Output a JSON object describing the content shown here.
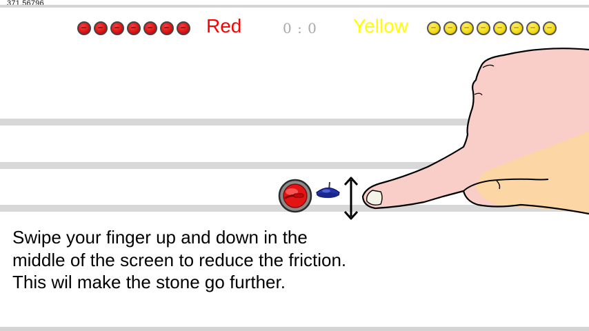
{
  "hud": {
    "debug_value": "371.56796",
    "red_team_label": "Red",
    "yellow_team_label": "Yellow",
    "score": "0 : 0",
    "red_stones_remaining": 7,
    "yellow_stones_remaining": 8,
    "colors": {
      "red": "#ff0000",
      "yellow": "#ffff00",
      "score": "#a9a9a9"
    }
  },
  "tutorial": {
    "instruction_text": "Swipe your finger up and down in the middle of the screen to reduce the friction. This wil make the stone go further."
  },
  "icons": [
    "curling-stone-red-icon",
    "curling-stone-yellow-icon",
    "curling-stone-blue-icon",
    "up-down-arrow-icon",
    "pointing-hand-icon"
  ]
}
